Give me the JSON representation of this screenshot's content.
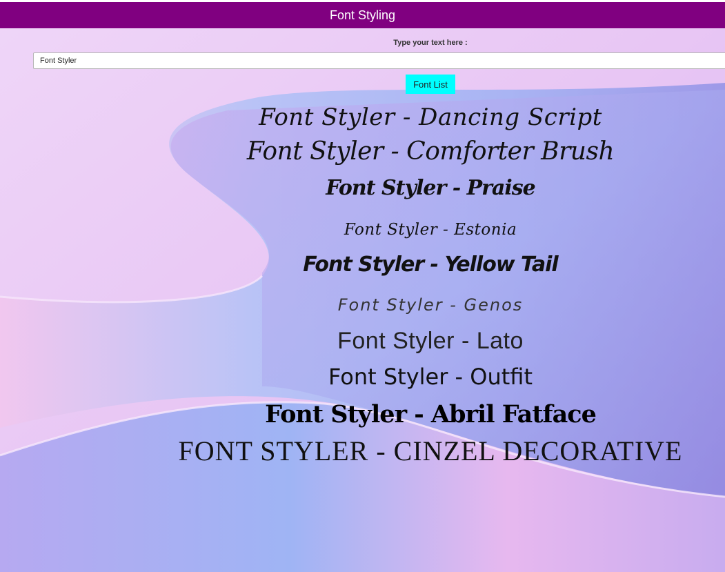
{
  "app": {
    "title": "Font Styling"
  },
  "form": {
    "label": "Type your text here :",
    "input_value": "Font Styler",
    "button_label": "Font List"
  },
  "fonts": [
    "Font Styler - Dancing Script",
    "Font Styler - Comforter Brush",
    "Font Styler - Praise",
    "Font Styler - Estonia",
    "Font Styler - Yellow Tail",
    "Font Styler - Genos",
    "Font Styler - Lato",
    "Font Styler - Outfit",
    "Font Styler - Abril Fatface",
    "FONT STYLER - CINZEL DECORATIVE"
  ],
  "colors": {
    "header_bg": "#800080",
    "header_text": "#ffffff",
    "button_bg": "#00ffff"
  }
}
